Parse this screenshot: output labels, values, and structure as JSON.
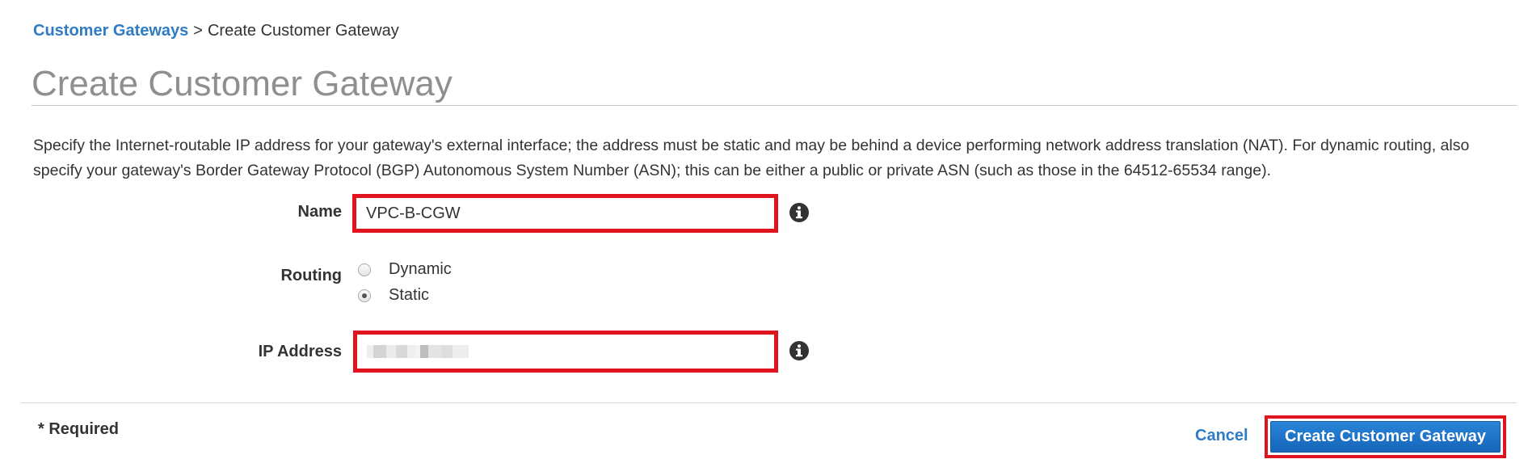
{
  "breadcrumb": {
    "parent": "Customer Gateways",
    "separator": ">",
    "current": "Create Customer Gateway"
  },
  "page_title": "Create Customer Gateway",
  "description": "Specify the Internet-routable IP address for your gateway's external interface; the address must be static and may be behind a device performing network address translation (NAT). For dynamic routing, also specify your gateway's Border Gateway Protocol (BGP) Autonomous System Number (ASN); this can be either a public or private ASN (such as those in the 64512-65534 range).",
  "form": {
    "name": {
      "label": "Name",
      "value": "VPC-B-CGW",
      "info_icon": "info-circle-icon"
    },
    "routing": {
      "label": "Routing",
      "options": [
        {
          "label": "Dynamic",
          "selected": false
        },
        {
          "label": "Static",
          "selected": true
        }
      ]
    },
    "ip_address": {
      "label": "IP Address",
      "value_redacted": true,
      "info_icon": "info-circle-icon"
    }
  },
  "footer": {
    "required_note": "* Required",
    "cancel_label": "Cancel",
    "submit_label": "Create Customer Gateway"
  },
  "colors": {
    "link": "#2f7bc4",
    "title": "#8f8f8f",
    "highlight_border": "#e0141e",
    "primary_button": "#1f74c8"
  }
}
